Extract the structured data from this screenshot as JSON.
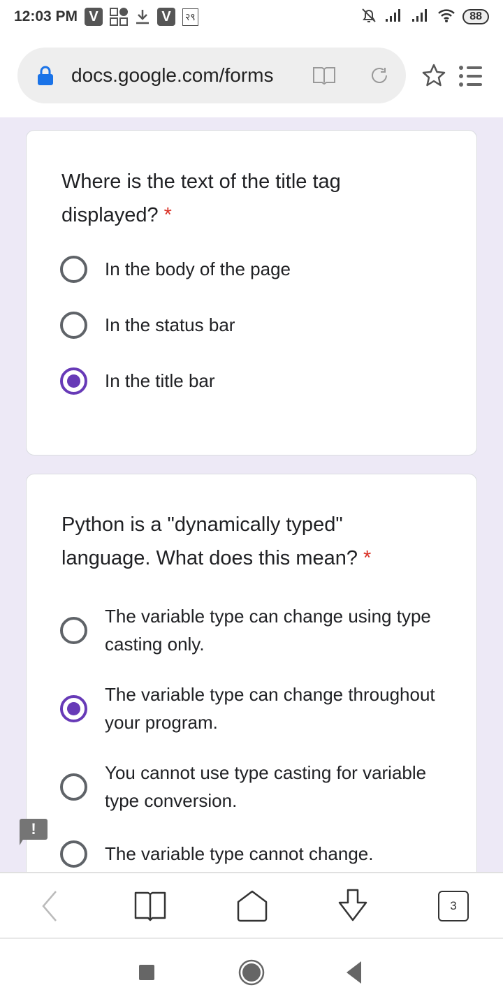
{
  "status_bar": {
    "time": "12:03 PM",
    "app_badge": "V",
    "lang_badge": "२९",
    "battery": "88"
  },
  "browser": {
    "url": "docs.google.com/forms",
    "tab_count": "3"
  },
  "accent_color": "#673ab7",
  "questions": [
    {
      "text": "Where is the text of the title tag displayed?",
      "required": "*",
      "options": [
        "In the body of the page",
        "In the status bar",
        "In the title bar"
      ],
      "selected": 2
    },
    {
      "text": "Python is a \"dynamically typed\" language. What does this mean?",
      "required": "*",
      "options": [
        "The variable type can change using type casting only.",
        "The variable type can change throughout your program.",
        "You cannot use type casting for variable type conversion.",
        "The variable type cannot change."
      ],
      "selected": 1
    }
  ],
  "feedback_badge": "!"
}
